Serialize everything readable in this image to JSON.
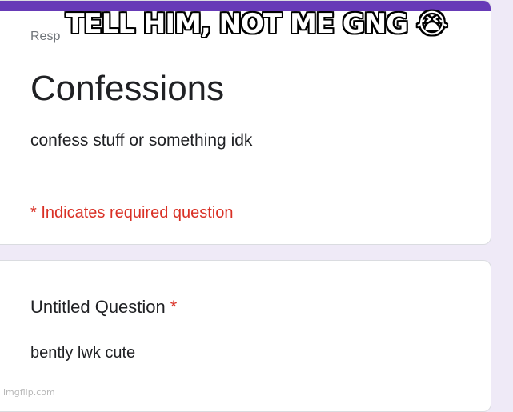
{
  "colors": {
    "accent": "#673ab7",
    "required": "#d93025",
    "page_bg": "#efeaf7"
  },
  "meme": {
    "caption": "TELL HIM, NOT ME GNG 😭"
  },
  "form": {
    "header_label": "Resp",
    "title": "Confessions",
    "description": "confess stuff or something idk",
    "required_note": "* Indicates required question"
  },
  "question": {
    "title": "Untitled Question",
    "required_marker": "*",
    "answer_value": "bently lwk cute"
  },
  "watermark": "imgflip.com"
}
